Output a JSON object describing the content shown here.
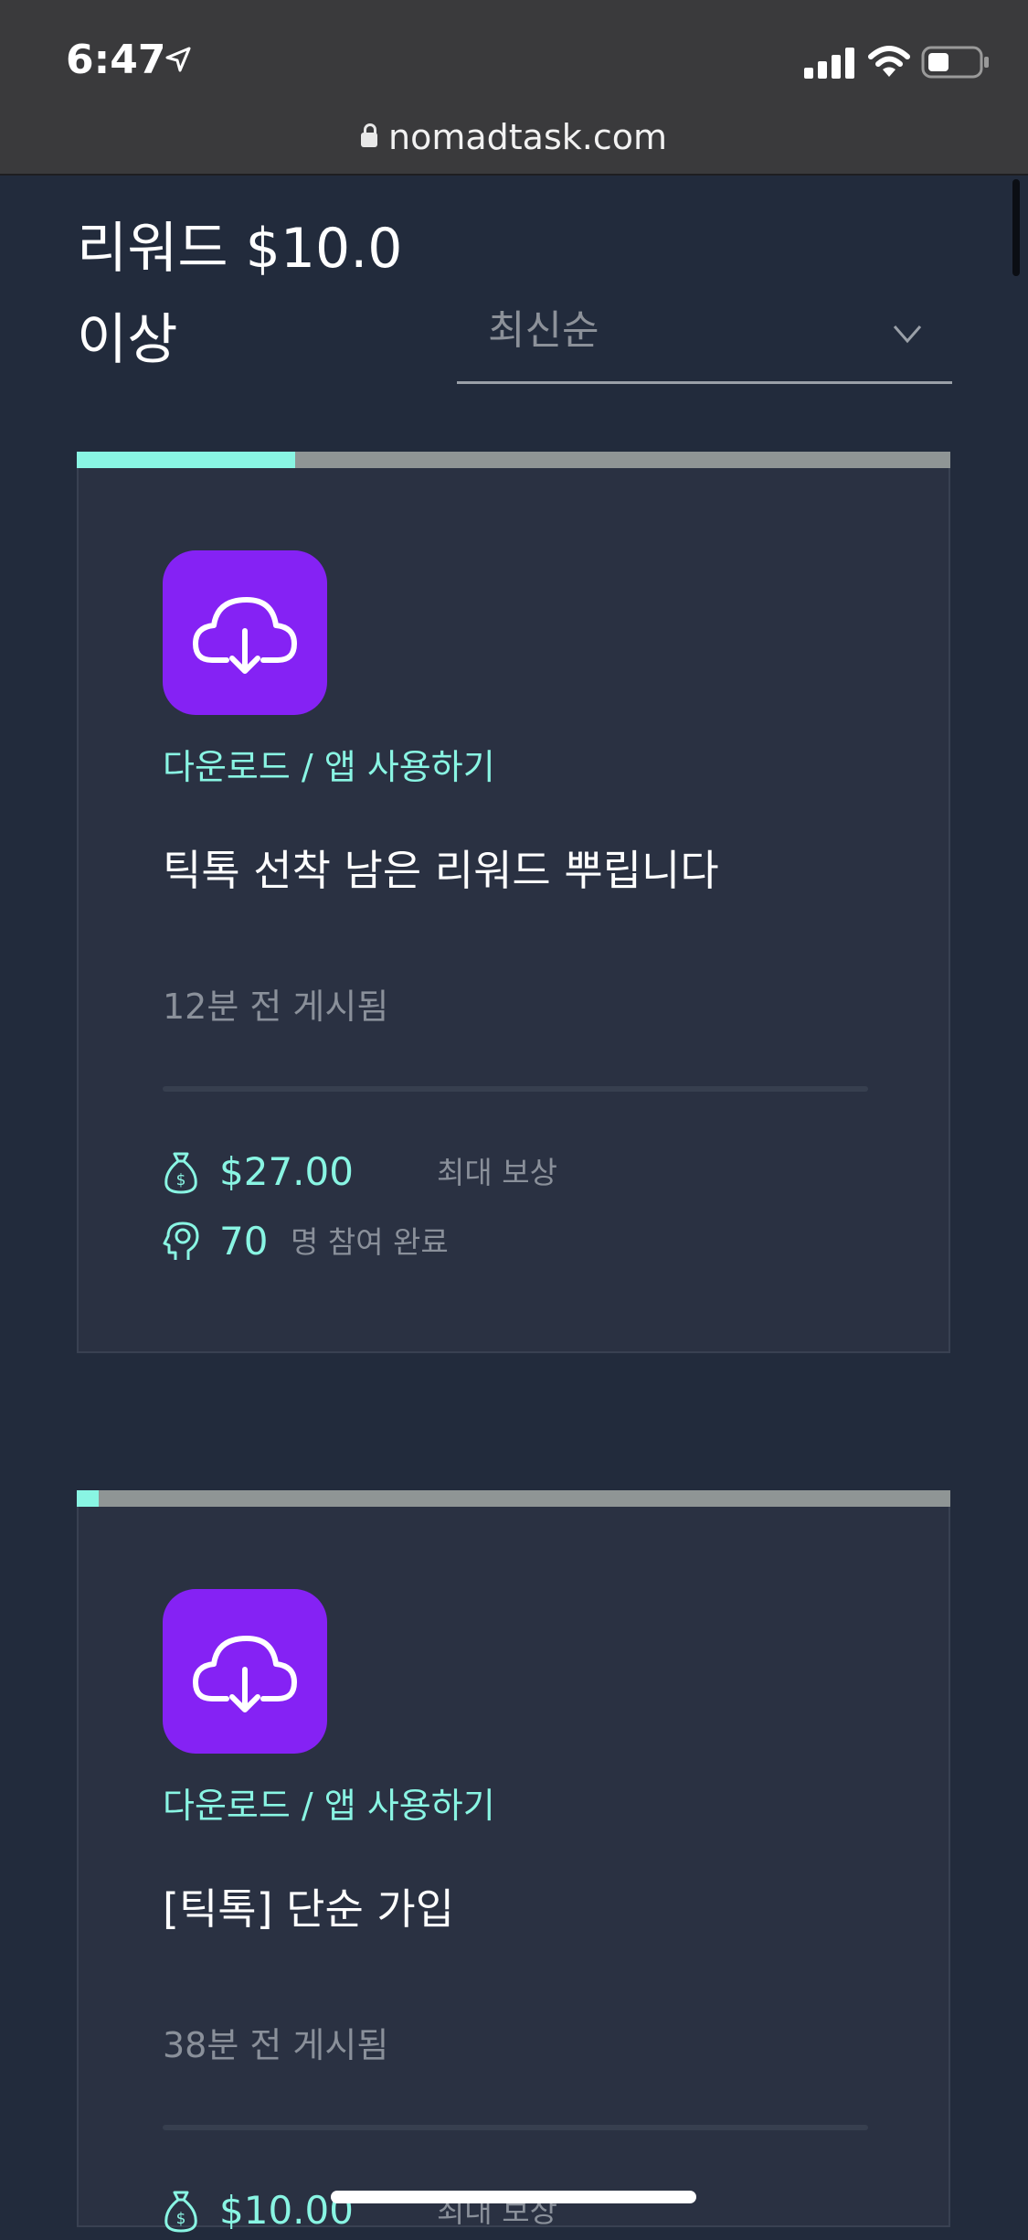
{
  "status_bar": {
    "time": "6:47",
    "url": "nomadtask.com"
  },
  "filter": {
    "title": "리워드 $10.0 이상",
    "sort_value": "최신순"
  },
  "colors": {
    "accent": "#89f5e3",
    "icon_bg": "#8522f4",
    "page_bg": "#222b3c",
    "card_bg": "#2a3142"
  },
  "tasks": [
    {
      "progress": 0.25,
      "icon": "cloud-download-icon",
      "category": "다운로드 / 앱 사용하기",
      "title": "틱톡 선착 남은 리워드 뿌립니다",
      "posted": "12분 전 게시됨",
      "reward_value": "$27.00",
      "reward_label": "최대 보상",
      "participants_value": "70",
      "participants_label": "명 참여 완료"
    },
    {
      "progress": 0.025,
      "icon": "cloud-download-icon",
      "category": "다운로드 / 앱 사용하기",
      "title": "[틱톡] 단순 가입",
      "posted": "38분 전 게시됨",
      "reward_value": "$10.00",
      "reward_label": "최대 보상"
    }
  ]
}
